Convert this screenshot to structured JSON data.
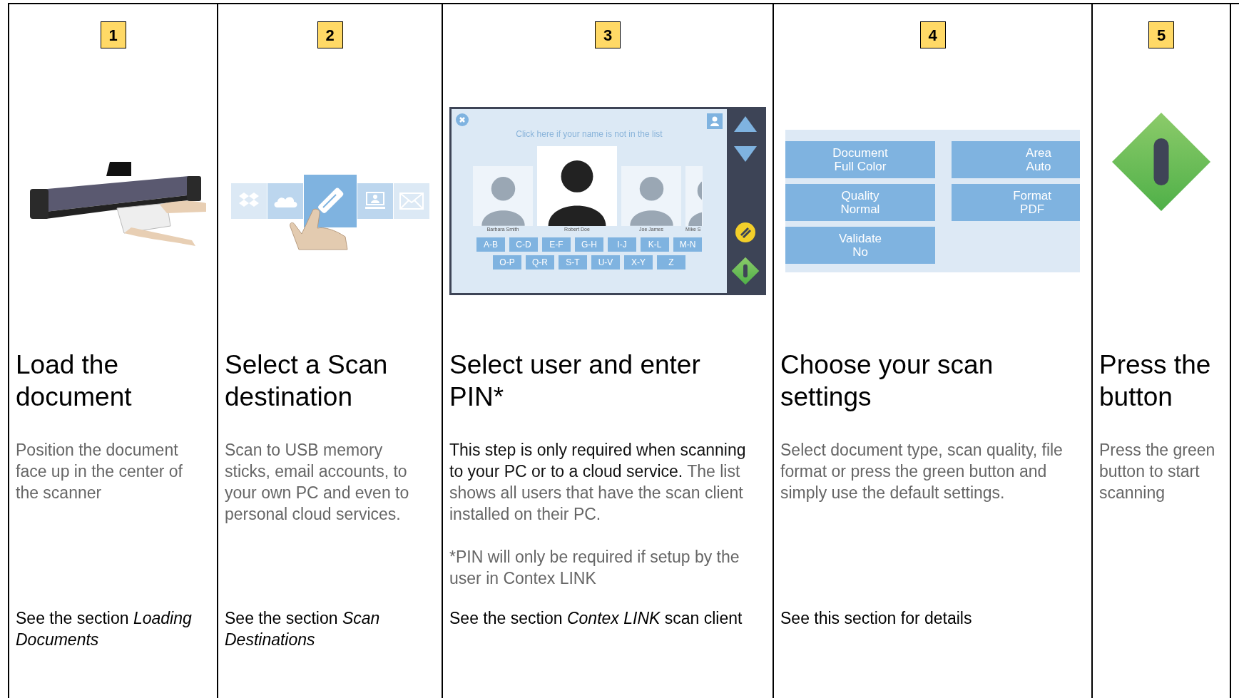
{
  "steps": [
    {
      "number": "1",
      "illustration": {
        "kind": "scanner"
      },
      "title": "Load the document",
      "description": [
        [
          {
            "text": "Position the document face up in the center of the scanner",
            "dark": false
          }
        ]
      ],
      "see_also": "See the section *Loading Documents*"
    },
    {
      "number": "2",
      "illustration": {
        "kind": "destinations"
      },
      "title": "Select a Scan destination",
      "description": [
        [
          {
            "text": "Scan to USB memory sticks, email accounts, to your own PC and even to personal cloud services.",
            "dark": false
          }
        ]
      ],
      "see_also": "See the section *Scan Destinations*"
    },
    {
      "number": "3",
      "illustration": {
        "kind": "user-screen",
        "prompt": "Click here if your name is not in the list",
        "users": [
          {
            "name": "Barbara Smith",
            "selected": false
          },
          {
            "name": "Robert Doe",
            "selected": true
          },
          {
            "name": "Joe James",
            "selected": false
          },
          {
            "name": "Mike S",
            "selected": false
          }
        ],
        "letter_rows": [
          [
            "A-B",
            "C-D",
            "E-F",
            "G-H",
            "I-J",
            "K-L",
            "M-N"
          ],
          [
            "O-P",
            "Q-R",
            "S-T",
            "U-V",
            "X-Y",
            "Z"
          ]
        ]
      },
      "title": "Select user and enter PIN*",
      "description": [
        [
          {
            "text": "This step is only required when scanning to your PC or to a cloud service.",
            "dark": true
          },
          {
            "text": " The list shows all users that have the scan client installed on their PC.",
            "dark": false
          }
        ],
        [
          {
            "text": "*PIN will only be required if setup by the user in Contex LINK",
            "dark": false
          }
        ]
      ],
      "see_also": "See the section *Contex LINK* scan client"
    },
    {
      "number": "4",
      "illustration": {
        "kind": "settings-panel",
        "settings": [
          {
            "label": "Document",
            "value": "Full Color"
          },
          {
            "label": "Area",
            "value": "Auto"
          },
          {
            "label": "Quality",
            "value": "Normal"
          },
          {
            "label": "Format",
            "value": "PDF"
          },
          {
            "label": "Validate",
            "value": "No"
          }
        ]
      },
      "title": "Choose your scan settings",
      "description": [
        [
          {
            "text": "Select document type, scan quality, file format or press the green button and simply use the default settings.",
            "dark": false
          }
        ]
      ],
      "see_also": "See this section for details"
    },
    {
      "number": "5",
      "illustration": {
        "kind": "start-button"
      },
      "title": "Press the button",
      "description": [
        [
          {
            "text": "Press the green button to start scanning",
            "dark": false
          }
        ]
      ]
    }
  ]
}
